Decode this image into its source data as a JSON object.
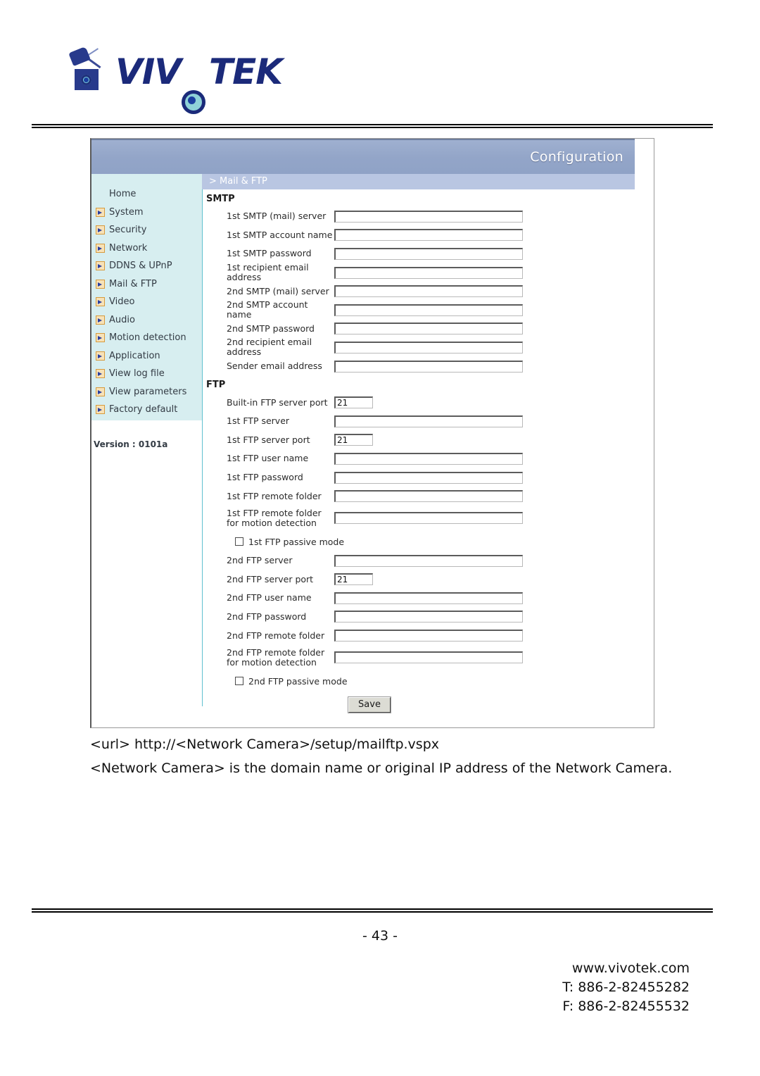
{
  "document": {
    "brand": "VIVOTEK",
    "page_number": "- 43 -",
    "url_line": "<url> http://<Network Camera>/setup/mailftp.vspx",
    "description": "<Network Camera> is the domain name or original IP address of the Network Camera.",
    "footer": {
      "website": "www.vivotek.com",
      "phone": "T: 886-2-82455282",
      "fax": "F: 886-2-82455532"
    }
  },
  "ui": {
    "header_title": "Configuration",
    "breadcrumb": "> Mail & FTP",
    "version": "Version : 0101a",
    "sidebar": {
      "items": [
        {
          "label": "Home",
          "has_arrow": false
        },
        {
          "label": "System",
          "has_arrow": true
        },
        {
          "label": "Security",
          "has_arrow": true
        },
        {
          "label": "Network",
          "has_arrow": true
        },
        {
          "label": "DDNS & UPnP",
          "has_arrow": true
        },
        {
          "label": "Mail & FTP",
          "has_arrow": true
        },
        {
          "label": "Video",
          "has_arrow": true
        },
        {
          "label": "Audio",
          "has_arrow": true
        },
        {
          "label": "Motion detection",
          "has_arrow": true
        },
        {
          "label": "Application",
          "has_arrow": true
        },
        {
          "label": "View log file",
          "has_arrow": true
        },
        {
          "label": "View parameters",
          "has_arrow": true
        },
        {
          "label": "Factory default",
          "has_arrow": true
        }
      ]
    },
    "smtp": {
      "heading": "SMTP",
      "fields": [
        {
          "label": "1st SMTP (mail) server",
          "value": "",
          "size": "wide"
        },
        {
          "label": "1st SMTP account name",
          "value": "",
          "size": "wide"
        },
        {
          "label": "1st SMTP password",
          "value": "",
          "size": "wide"
        },
        {
          "label": "1st recipient email address",
          "value": "",
          "size": "wide"
        },
        {
          "label": "2nd SMTP (mail) server",
          "value": "",
          "size": "wide"
        },
        {
          "label": "2nd SMTP account name",
          "value": "",
          "size": "wide"
        },
        {
          "label": "2nd SMTP password",
          "value": "",
          "size": "wide"
        },
        {
          "label": "2nd recipient email address",
          "value": "",
          "size": "wide"
        },
        {
          "label": "Sender email address",
          "value": "",
          "size": "wide"
        }
      ]
    },
    "ftp": {
      "heading": "FTP",
      "fields": [
        {
          "label": "Built-in FTP server port",
          "value": "21",
          "size": "small"
        },
        {
          "label": "1st FTP server",
          "value": "",
          "size": "wide"
        },
        {
          "label": "1st FTP server port",
          "value": "21",
          "size": "small"
        },
        {
          "label": "1st FTP user name",
          "value": "",
          "size": "wide"
        },
        {
          "label": "1st FTP password",
          "value": "",
          "size": "wide"
        },
        {
          "label": "1st FTP remote folder",
          "value": "",
          "size": "wide"
        },
        {
          "label": "1st FTP remote folder for motion detection",
          "value": "",
          "size": "wide",
          "tall": true
        }
      ],
      "passive_1": {
        "label": "1st FTP passive mode",
        "checked": false
      },
      "fields2": [
        {
          "label": "2nd FTP server",
          "value": "",
          "size": "wide"
        },
        {
          "label": "2nd FTP server port",
          "value": "21",
          "size": "small"
        },
        {
          "label": "2nd FTP user name",
          "value": "",
          "size": "wide"
        },
        {
          "label": "2nd FTP password",
          "value": "",
          "size": "wide"
        },
        {
          "label": "2nd FTP remote folder",
          "value": "",
          "size": "wide"
        },
        {
          "label": "2nd FTP remote folder for motion detection",
          "value": "",
          "size": "wide",
          "tall": true
        }
      ],
      "passive_2": {
        "label": "2nd FTP passive mode",
        "checked": false
      }
    },
    "save_label": "Save",
    "colors": {
      "header_blue": "#93a5c8",
      "bread_blue": "#b9c6e2",
      "sidebar_mint": "#d7eef0",
      "divider_cyan": "#5fc0cf",
      "brand_navy": "#1b2a7a"
    }
  }
}
